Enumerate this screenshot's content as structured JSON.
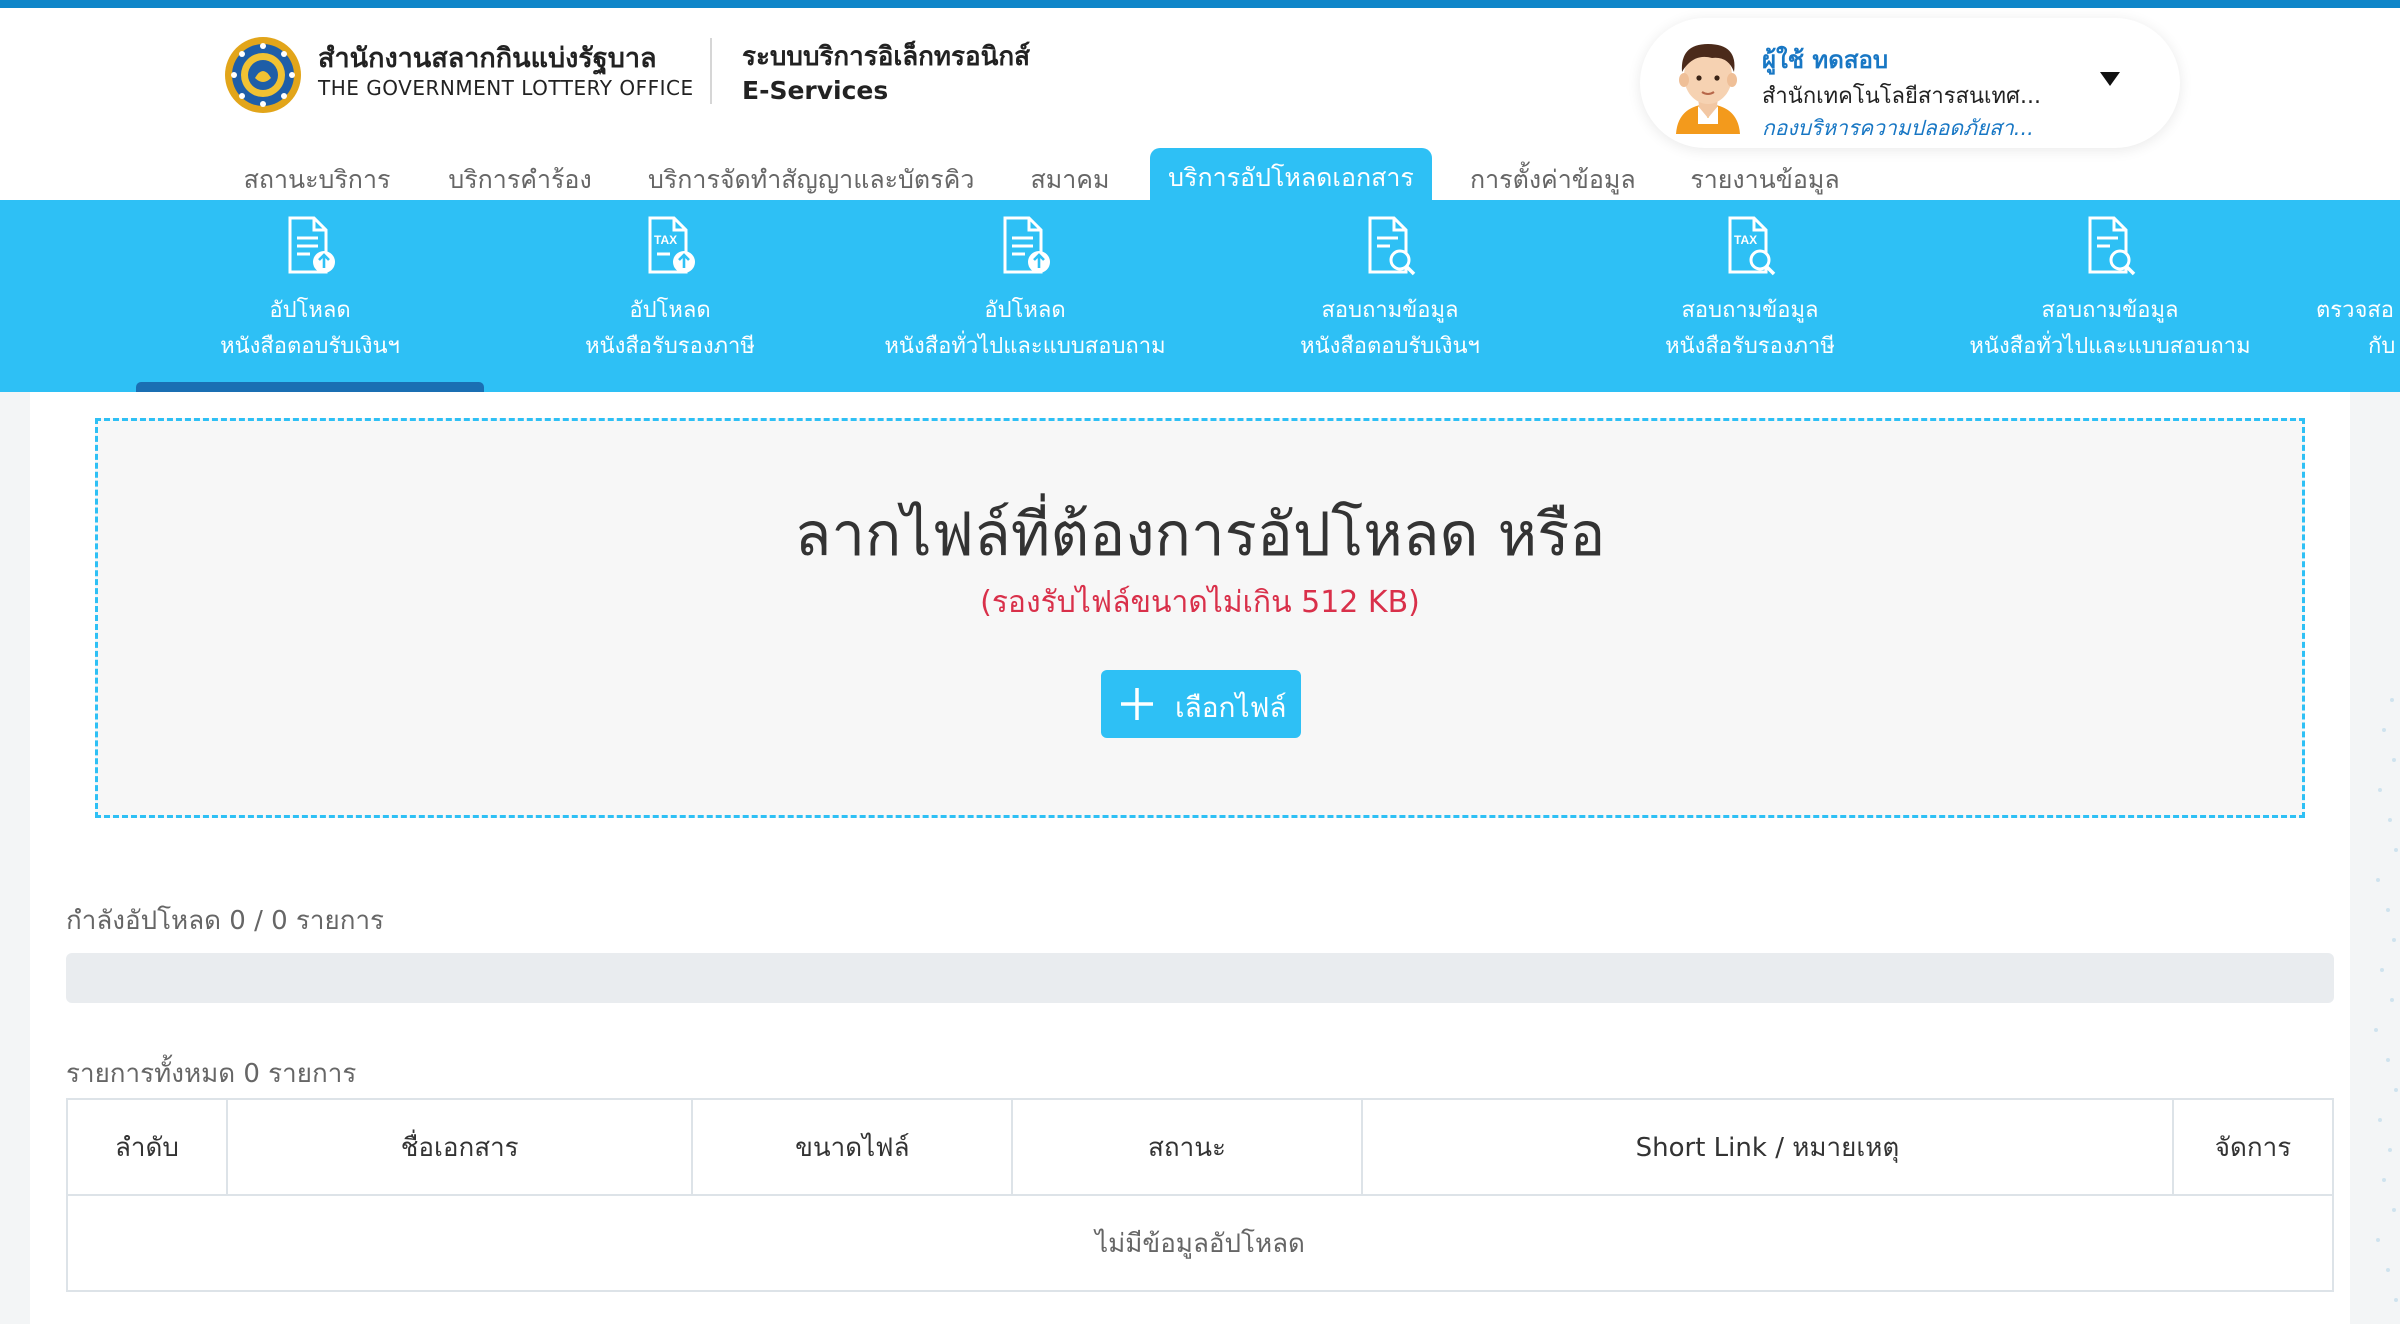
{
  "header": {
    "org_name_th": "สำนักงานสลากกินแบ่งรัฐบาล",
    "org_name_en": "THE GOVERNMENT LOTTERY OFFICE",
    "system_name_th": "ระบบบริการอิเล็กทรอนิกส์",
    "system_name_en": "E-Services",
    "logo_icon": "glo-emblem-icon"
  },
  "user": {
    "name": "ผู้ใช้ ทดสอบ",
    "department": "สำนักเทคโนโลยีสารสนเทศ...",
    "division": "กองบริหารความปลอดภัยสา...",
    "avatar_icon": "user-avatar-icon",
    "dropdown_icon": "caret-down-icon"
  },
  "main_nav": [
    {
      "label": "สถานะบริการ",
      "active": false
    },
    {
      "label": "บริการคำร้อง",
      "active": false
    },
    {
      "label": "บริการจัดทำสัญญาและบัตรคิว",
      "active": false
    },
    {
      "label": "สมาคม",
      "active": false
    },
    {
      "label": "บริการอัปโหลดเอกสาร",
      "active": true
    },
    {
      "label": "การตั้งค่าข้อมูล",
      "active": false
    },
    {
      "label": "รายงานข้อมูล",
      "active": false
    }
  ],
  "sub_nav": [
    {
      "line1": "อัปโหลด",
      "line2": "หนังสือตอบรับเงินฯ",
      "icon": "document-upload-icon",
      "active": true
    },
    {
      "line1": "อัปโหลด",
      "line2": "หนังสือรับรองภาษี",
      "icon": "tax-document-upload-icon",
      "active": false
    },
    {
      "line1": "อัปโหลด",
      "line2": "หนังสือทั่วไปและแบบสอบถาม",
      "icon": "document-upload-icon",
      "active": false
    },
    {
      "line1": "สอบถามข้อมูล",
      "line2": "หนังสือตอบรับเงินฯ",
      "icon": "document-search-icon",
      "active": false
    },
    {
      "line1": "สอบถามข้อมูล",
      "line2": "หนังสือรับรองภาษี",
      "icon": "tax-document-search-icon",
      "active": false
    },
    {
      "line1": "สอบถามข้อมูล",
      "line2": "หนังสือทั่วไปและแบบสอบถาม",
      "icon": "document-search-icon",
      "active": false
    },
    {
      "line1": "ตรวจสอ",
      "line2": "กับ",
      "icon": "document-check-icon",
      "active": false
    }
  ],
  "upload": {
    "title": "ลากไฟล์ที่ต้องการอัปโหลด หรือ",
    "size_note": "(รองรับไฟล์ขนาดไม่เกิน 512 KB)",
    "choose_button": "เลือกไฟล์",
    "button_icon": "plus-icon"
  },
  "progress": {
    "label": "กำลังอัปโหลด 0 / 0 รายการ",
    "percent": 0
  },
  "table": {
    "total_label": "รายการทั้งหมด 0 รายการ",
    "columns": [
      "ลำดับ",
      "ชื่อเอกสาร",
      "ขนาดไฟล์",
      "สถานะ",
      "Short Link / หมายเหตุ",
      "จัดการ"
    ],
    "empty_message": "ไม่มีข้อมูลอัปโหลด"
  },
  "colors": {
    "primary": "#2ec0f5",
    "top_stripe": "#0f86c9",
    "active_underline": "#1a6fb3",
    "user_link": "#1877c4",
    "note_red": "#d9304a"
  }
}
